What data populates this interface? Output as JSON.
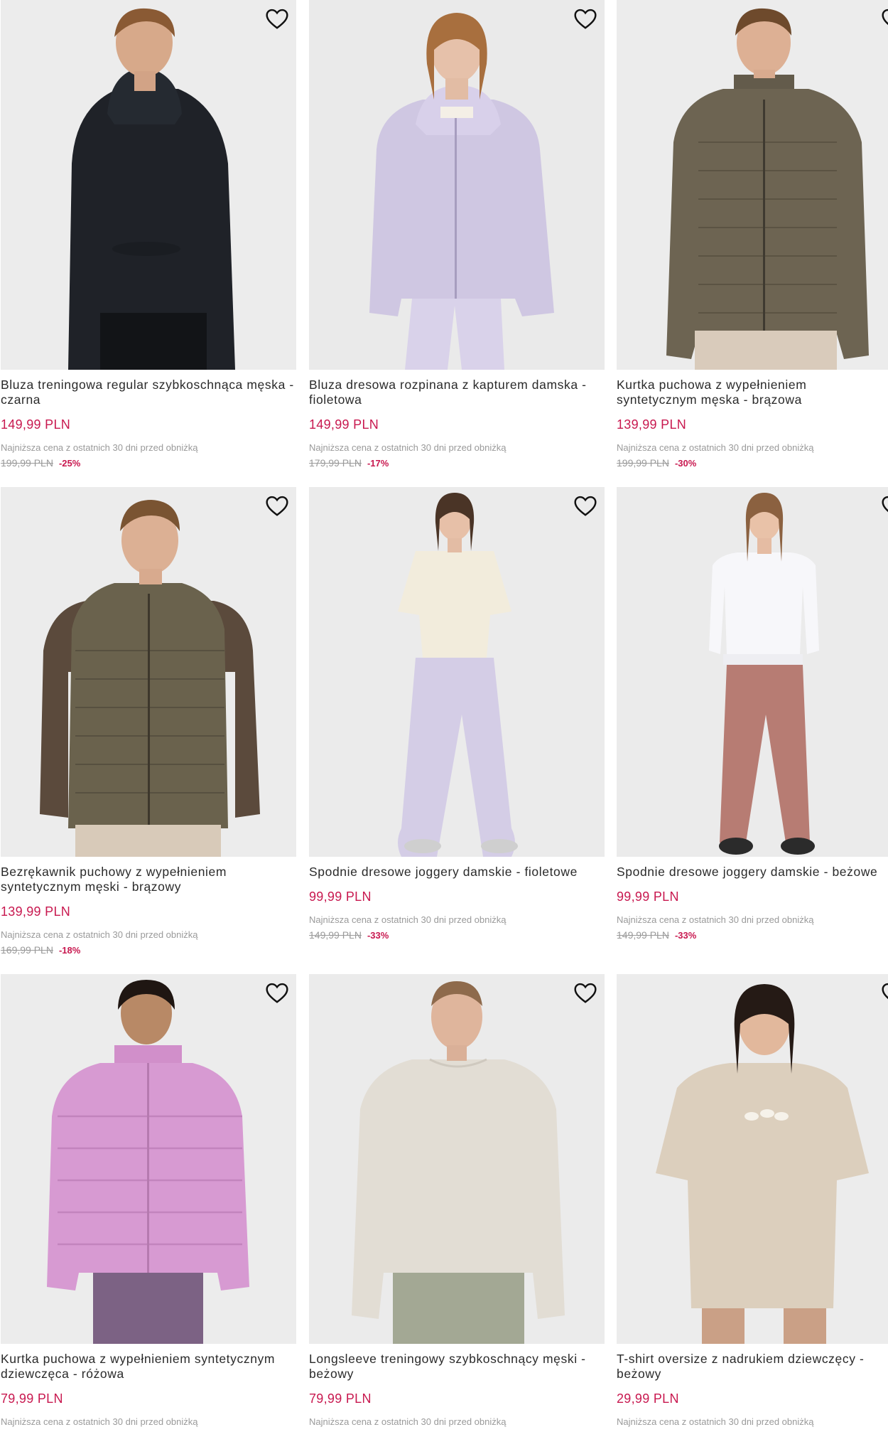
{
  "products": [
    {
      "name": "Bluza treningowa regular szybkoschnąca męska - czarna",
      "price": "149,99 PLN",
      "lowest_label": "Najniższa cena z ostatnich 30 dni przed obniżką",
      "old_price": "199,99 PLN",
      "discount": "-25%"
    },
    {
      "name": "Bluza dresowa rozpinana z kapturem damska - fioletowa",
      "price": "149,99 PLN",
      "lowest_label": "Najniższa cena z ostatnich 30 dni przed obniżką",
      "old_price": "179,99 PLN",
      "discount": "-17%"
    },
    {
      "name": "Kurtka puchowa z wypełnieniem syntetycznym męska - brązowa",
      "price": "139,99 PLN",
      "lowest_label": "Najniższa cena z ostatnich 30 dni przed obniżką",
      "old_price": "199,99 PLN",
      "discount": "-30%"
    },
    {
      "name": "Bezrękawnik puchowy z wypełnieniem syntetycznym męski - brązowy",
      "price": "139,99 PLN",
      "lowest_label": "Najniższa cena z ostatnich 30 dni przed obniżką",
      "old_price": "169,99 PLN",
      "discount": "-18%"
    },
    {
      "name": "Spodnie dresowe joggery damskie - fioletowe",
      "price": "99,99 PLN",
      "lowest_label": "Najniższa cena z ostatnich 30 dni przed obniżką",
      "old_price": "149,99 PLN",
      "discount": "-33%"
    },
    {
      "name": "Spodnie dresowe joggery damskie - beżowe",
      "price": "99,99 PLN",
      "lowest_label": "Najniższa cena z ostatnich 30 dni przed obniżką",
      "old_price": "149,99 PLN",
      "discount": "-33%"
    },
    {
      "name": "Kurtka puchowa z wypełnieniem syntetycznym dziewczęca - różowa",
      "price": "79,99 PLN",
      "lowest_label": "Najniższa cena z ostatnich 30 dni przed obniżką"
    },
    {
      "name": "Longsleeve treningowy szybkoschnący męski - beżowy",
      "price": "79,99 PLN",
      "lowest_label": "Najniższa cena z ostatnich 30 dni przed obniżką"
    },
    {
      "name": "T-shirt oversize z nadrukiem dziewczęcy - beżowy",
      "price": "29,99 PLN",
      "lowest_label": "Najniższa cena z ostatnich 30 dni przed obniżką"
    }
  ],
  "icons": {
    "wishlist": "heart-outline-icon"
  },
  "colors": {
    "price_accent": "#c8184f",
    "muted_text": "#9a9a9a",
    "name_text": "#2a2a2a",
    "photo_background": "#ededed"
  }
}
